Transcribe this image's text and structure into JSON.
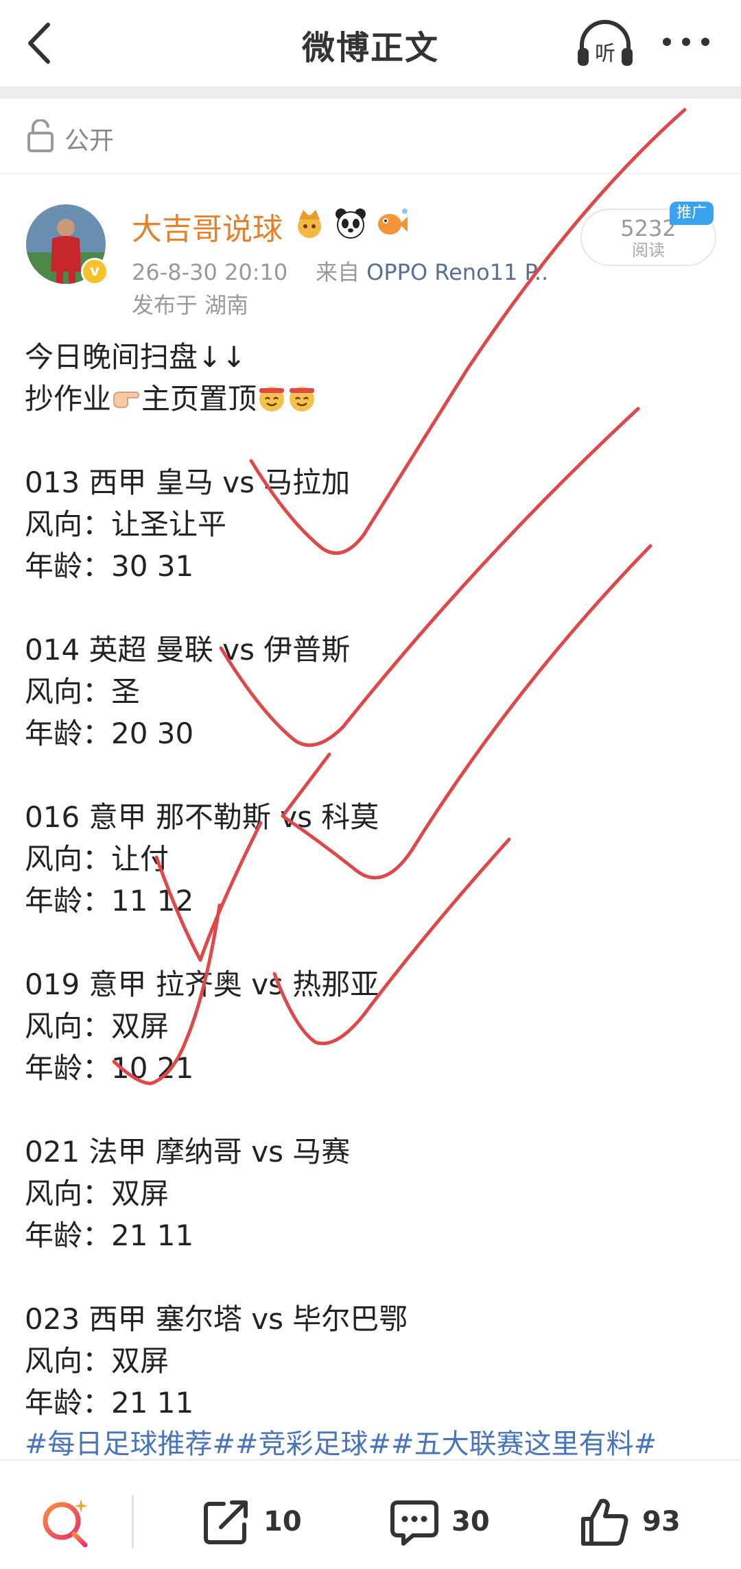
{
  "header": {
    "title": "微博正文",
    "listen_label": "听"
  },
  "visibility": {
    "label": "公开"
  },
  "author": {
    "name": "大吉哥说球",
    "verified_mark": "v",
    "timestamp": "26-8-30 20:10",
    "source_prefix": "来自",
    "device": "OPPO Reno11 P..",
    "location": "发布于 湖南",
    "badges": [
      "crown-icon",
      "panda-icon",
      "fish-icon"
    ]
  },
  "reads": {
    "count": "5232",
    "label": "阅读",
    "promo_tag": "推广"
  },
  "post": {
    "intro_line1": "今日晚间扫盘↓↓",
    "intro_line2": "抄作业",
    "intro_line2b": "主页置顶",
    "matches": [
      {
        "line": "013 西甲 皇马 vs 马拉加",
        "wind": "风向：让圣让平",
        "age": "年龄：30  31"
      },
      {
        "line": "014 英超 曼联 vs 伊普斯",
        "wind": "风向：圣",
        "age": "年龄：20  30"
      },
      {
        "line": "016 意甲 那不勒斯 vs 科莫",
        "wind": "风向：让付",
        "age": "年龄：11  12"
      },
      {
        "line": "019 意甲 拉齐奥 vs 热那亚",
        "wind": "风向：双屏",
        "age": "年龄：10  21"
      },
      {
        "line": "021 法甲 摩纳哥 vs 马赛",
        "wind": "风向：双屏",
        "age": "年龄：21  11"
      },
      {
        "line": "023 西甲 塞尔塔 vs 毕尔巴鄂",
        "wind": "风向：双屏",
        "age": "年龄：21  11"
      }
    ],
    "hashtags": "#每日足球推荐##竞彩足球##五大联赛这里有料#"
  },
  "actions": {
    "share_count": "10",
    "comment_count": "30",
    "like_count": "93"
  },
  "colors": {
    "username": "#e8802a",
    "link": "#4a74b8",
    "checkmark": "#e04848",
    "promo": "#3aa1f0"
  }
}
